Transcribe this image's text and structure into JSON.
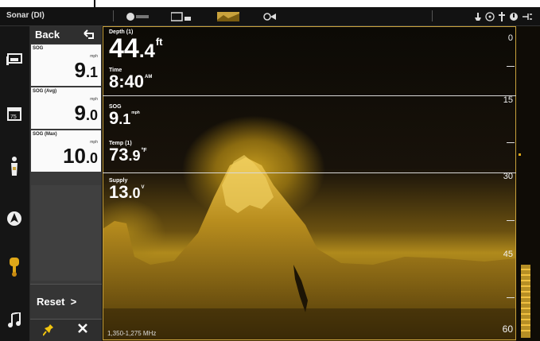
{
  "app": {
    "title": "Sonar (DI)"
  },
  "topbar": {
    "icons": [
      "wind-icon",
      "grid-icon",
      "sonar-chart-icon",
      "fish-alarm-icon"
    ],
    "status_icons": [
      "boat-icon",
      "steering-icon",
      "anchor-icon",
      "power-icon",
      "transducer-icon"
    ]
  },
  "panel": {
    "back_label": "Back",
    "stats": [
      {
        "label": "SOG",
        "unit": "mph",
        "whole": "9",
        "decimal": ".1"
      },
      {
        "label": "SOG (Avg)",
        "unit": "mph",
        "whole": "9",
        "decimal": ".0"
      },
      {
        "label": "SOG (Max)",
        "unit": "mph",
        "whole": "10",
        "decimal": ".0"
      }
    ],
    "reset_label": "Reset",
    "reset_arrow": ">"
  },
  "readouts": {
    "depth": {
      "label": "Depth (1)",
      "value": "44",
      "decimal": ".4",
      "unit": "ft"
    },
    "time": {
      "label": "Time",
      "value": "8:40",
      "unit": "AM"
    },
    "sog": {
      "label": "SOG",
      "value": "9",
      "decimal": ".1",
      "unit": "mph"
    },
    "temp": {
      "label": "Temp (1)",
      "value": "73",
      "decimal": ".9",
      "unit": "°F"
    },
    "supply": {
      "label": "Supply",
      "value": "13",
      "decimal": ".0",
      "unit": "V"
    }
  },
  "depth_scale": [
    "0",
    "15",
    "30",
    "45",
    "60"
  ],
  "frequency": "1,350-1,275 MHz",
  "colors": {
    "accent": "#d4a72c",
    "sonar_bg": "#0c0a05"
  }
}
